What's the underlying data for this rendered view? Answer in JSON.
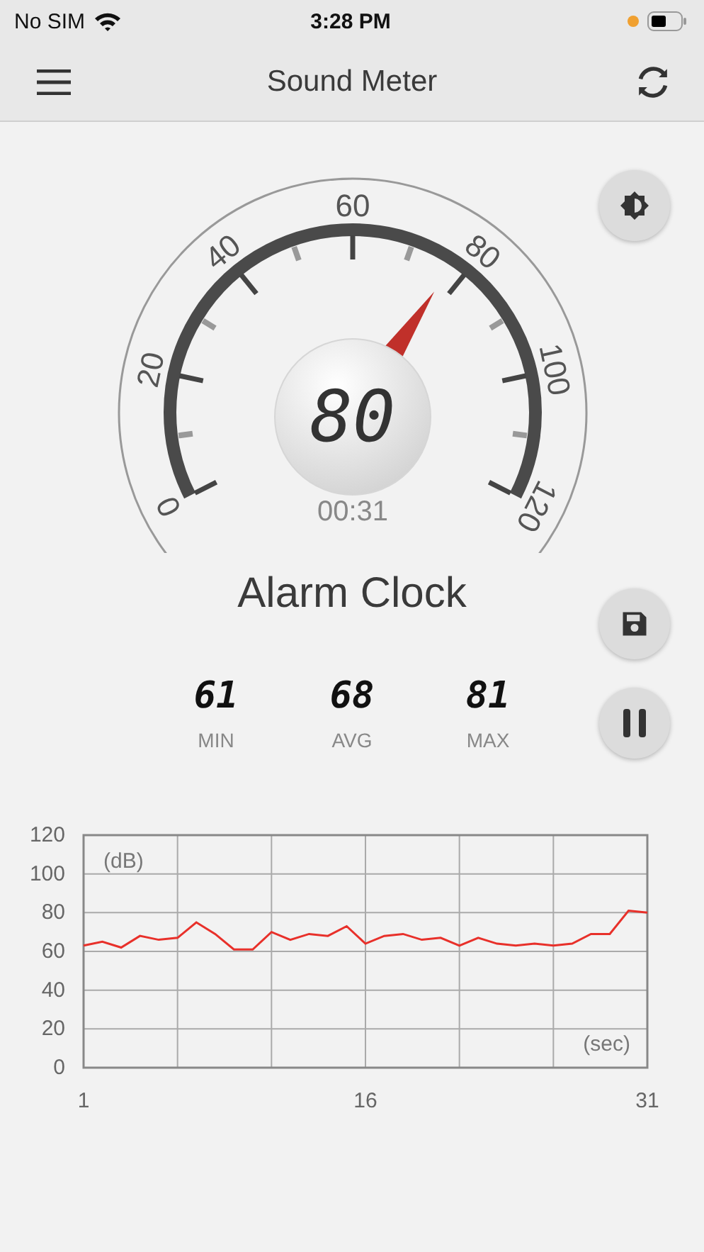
{
  "status_bar": {
    "carrier": "No SIM",
    "time": "3:28 PM"
  },
  "nav": {
    "title": "Sound Meter"
  },
  "gauge": {
    "reading": "80",
    "timer": "00:31",
    "scale": [
      "0",
      "20",
      "40",
      "60",
      "80",
      "100",
      "120"
    ]
  },
  "source_name": "Alarm Clock",
  "stats": [
    {
      "value": "61",
      "label": "MIN"
    },
    {
      "value": "68",
      "label": "AVG"
    },
    {
      "value": "81",
      "label": "MAX"
    }
  ],
  "history": {
    "chart_data": {
      "type": "line",
      "grid": true,
      "xlabel": "(sec)",
      "ylabel": "(dB)",
      "x": [
        1,
        2,
        3,
        4,
        5,
        6,
        7,
        8,
        9,
        10,
        11,
        12,
        13,
        14,
        15,
        16,
        17,
        18,
        19,
        20,
        21,
        22,
        23,
        24,
        25,
        26,
        27,
        28,
        29,
        30,
        31
      ],
      "xlim": [
        1,
        31
      ],
      "ylim": [
        0,
        120
      ],
      "xticks": [
        1,
        16,
        31
      ],
      "yticks": [
        0,
        20,
        40,
        60,
        80,
        100,
        120
      ],
      "series": [
        {
          "color": "#e8302a",
          "values": [
            63,
            65,
            62,
            68,
            66,
            67,
            75,
            69,
            61,
            61,
            70,
            66,
            69,
            68,
            73,
            64,
            68,
            69,
            66,
            67,
            63,
            67,
            64,
            63,
            64,
            63,
            64,
            69,
            69,
            81,
            80
          ]
        }
      ]
    }
  }
}
